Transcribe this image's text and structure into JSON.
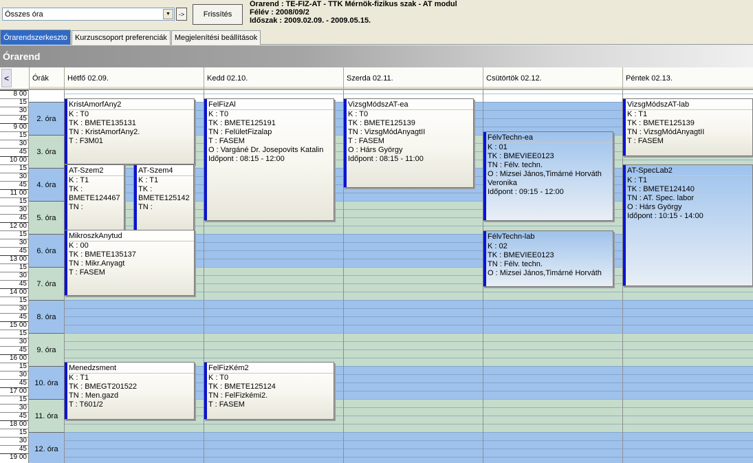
{
  "topbar": {
    "filter_value": "Összes óra",
    "go_label": "->",
    "refresh_label": "Frissítés",
    "info_line1": "Órarend : TE-FIZ-AT - TTK Mérnök-fizikus szak - AT modul",
    "info_line2": "Félév : 2008/09/2",
    "info_line3": "Időszak : 2009.02.09. - 2009.05.15."
  },
  "tabs": [
    "Órarendszerkeszto",
    "Kurzuscsoport preferenciák",
    "Megjelenítési beállítások"
  ],
  "section_title": "Órarend",
  "grid": {
    "scroll_left": "<",
    "hours_label": "Órák",
    "days": [
      "Hétfő  02.09.",
      "Kedd  02.10.",
      "Szerda  02.11.",
      "Csütörtök  02.12.",
      "Péntek  02.13."
    ],
    "time_labels": [
      "8 00",
      "15",
      "30",
      "45",
      "9 00",
      "15",
      "30",
      "45",
      "10 00",
      "15",
      "30",
      "45",
      "11 00",
      "15",
      "30",
      "45",
      "12 00",
      "15",
      "30",
      "45",
      "13 00",
      "15",
      "30",
      "45",
      "14 00",
      "15",
      "30",
      "45",
      "15 00",
      "15",
      "30",
      "45",
      "16 00",
      "15",
      "30",
      "45",
      "17 00",
      "15",
      "30",
      "45",
      "18 00",
      "15",
      "30",
      "45",
      "19 00"
    ],
    "lessons": [
      "2. óra",
      "3. óra",
      "4. óra",
      "5. óra",
      "6. óra",
      "7. óra",
      "8. óra",
      "9. óra",
      "10. óra",
      "11. óra",
      "12. óra"
    ]
  },
  "events": [
    {
      "title": "KristAmorfAny2",
      "lines": [
        "K : T0",
        "TK : BMETE135131",
        "TN : KristAmorfAny2.",
        "T : F3M01"
      ]
    },
    {
      "title": "AT-Szem2",
      "lines": [
        "K : T1",
        "TK :",
        "BMETE124467",
        "TN :"
      ]
    },
    {
      "title": "AT-Szem4",
      "lines": [
        "K : T1",
        "TK :",
        "BMETE125142",
        "TN :"
      ]
    },
    {
      "title": "MikroszkAnytud",
      "lines": [
        "K : 00",
        "TK : BMETE135137",
        "TN : Mikr.Anyagt",
        "T : FASEM"
      ]
    },
    {
      "title": "Menedzsment",
      "lines": [
        "K : T1",
        "TK : BMEGT201522",
        "TN : Men.gazd",
        "T : T601/2"
      ]
    },
    {
      "title": "FelFizAl",
      "lines": [
        "K : T0",
        "TK : BMETE125191",
        "TN : FelületFizalap",
        "T : FASEM",
        "O : Vargáné Dr. Josepovits Katalin",
        "Időpont : 08:15 - 12:00"
      ]
    },
    {
      "title": "FelFizKém2",
      "lines": [
        "K : T0",
        "TK : BMETE125124",
        "TN : FelFizkémi2.",
        "T : FASEM"
      ]
    },
    {
      "title": "VizsgMódszAT-ea",
      "lines": [
        "K : T0",
        "TK : BMETE125139",
        "TN : VizsgMódAnyagtII",
        "T : FASEM",
        "O : Hárs György",
        "Időpont : 08:15 - 11:00"
      ]
    },
    {
      "title": "FélvTechn-ea",
      "lines": [
        "K : 01",
        "TK : BMEVIEE0123",
        "TN : Félv. techn.",
        "O : Mizsei János,Timárné Horváth",
        "Veronika",
        "Időpont : 09:15 - 12:00"
      ]
    },
    {
      "title": "FélvTechn-lab",
      "lines": [
        "K : 02",
        "TK : BMEVIEE0123",
        "TN : Félv. techn.",
        "O : Mizsei János,Timárné Horváth"
      ]
    },
    {
      "title": "VizsgMódszAT-lab",
      "lines": [
        "K : T1",
        "TK : BMETE125139",
        "TN : VizsgMódAnyagtII",
        "T : FASEM"
      ]
    },
    {
      "title": "AT-SpecLab2",
      "lines": [
        "K : T1",
        "TK : BMETE124140",
        "TN : AT. Spec. labor",
        "O : Hárs György",
        "Időpont : 10:15 - 14:00"
      ]
    }
  ],
  "colors": {
    "slot_blue": "#9ec2ec",
    "slot_green": "#c5dccb",
    "event_bar": "#0a14d4",
    "tab_active": "#316ac5"
  }
}
